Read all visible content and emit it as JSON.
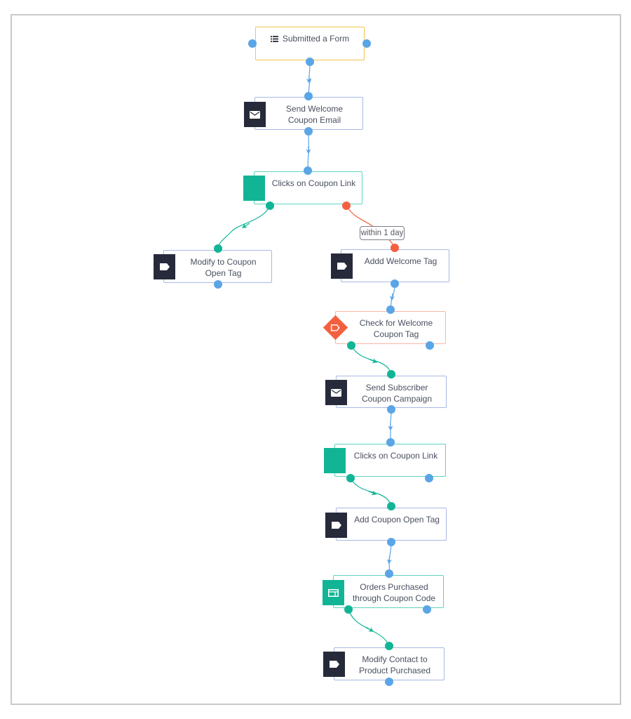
{
  "workflow": {
    "nodes": [
      {
        "id": "n1",
        "type": "trigger",
        "label": "Submitted a Form",
        "icon": "list-icon"
      },
      {
        "id": "n2",
        "type": "action",
        "label": "Send Welcome Coupon Email",
        "icon": "envelope-icon"
      },
      {
        "id": "n3",
        "type": "condition",
        "label": "Clicks on Coupon Link",
        "icon": "green-square-icon"
      },
      {
        "id": "n4",
        "type": "action",
        "label": "Modify to Coupon Open Tag",
        "icon": "tag-icon"
      },
      {
        "id": "n5",
        "type": "action",
        "label": "Addd Welcome Tag",
        "icon": "tag-icon"
      },
      {
        "id": "n6",
        "type": "check",
        "label": "Check for Welcome Coupon Tag",
        "icon": "tag-diamond-icon"
      },
      {
        "id": "n7",
        "type": "action",
        "label": "Send Subscriber Coupon Campaign",
        "icon": "envelope-icon"
      },
      {
        "id": "n8",
        "type": "condition",
        "label": "Clicks on Coupon Link",
        "icon": "green-square-icon"
      },
      {
        "id": "n9",
        "type": "action",
        "label": "Add Coupon Open Tag",
        "icon": "tag-icon"
      },
      {
        "id": "n10",
        "type": "condition",
        "label": "Orders Purchased through Coupon Code",
        "icon": "order-icon"
      },
      {
        "id": "n11",
        "type": "action",
        "label": "Modify Contact to Product Purchased",
        "icon": "tag-icon"
      }
    ],
    "edges": [
      {
        "from": "n1",
        "to": "n2",
        "branch": "default"
      },
      {
        "from": "n2",
        "to": "n3",
        "branch": "default"
      },
      {
        "from": "n3",
        "to": "n4",
        "branch": "yes"
      },
      {
        "from": "n3",
        "to": "n5",
        "branch": "no",
        "label": "within 1 day"
      },
      {
        "from": "n5",
        "to": "n6",
        "branch": "default"
      },
      {
        "from": "n6",
        "to": "n7",
        "branch": "yes"
      },
      {
        "from": "n7",
        "to": "n8",
        "branch": "default"
      },
      {
        "from": "n8",
        "to": "n9",
        "branch": "yes"
      },
      {
        "from": "n9",
        "to": "n10",
        "branch": "default"
      },
      {
        "from": "n10",
        "to": "n11",
        "branch": "yes"
      }
    ],
    "edge_label": "within 1 day"
  },
  "colors": {
    "default_edge": "#5aa5e6",
    "yes_edge": "#11b596",
    "no_edge": "#f4603f",
    "trigger_border": "#f5c34d",
    "action_border": "#a9b8e6",
    "condition_border": "#5fd3bd",
    "check_border": "#f7b7a3",
    "icon_dark": "#262a3a"
  }
}
